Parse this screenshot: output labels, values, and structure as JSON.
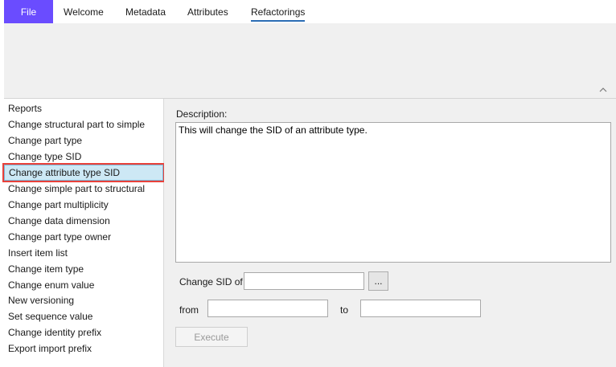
{
  "ribbon": {
    "file_label": "File",
    "tabs": [
      {
        "label": "Welcome"
      },
      {
        "label": "Metadata"
      },
      {
        "label": "Attributes"
      },
      {
        "label": "Refactorings",
        "active": true
      }
    ]
  },
  "sidebar": {
    "items": [
      {
        "label": "Reports"
      },
      {
        "label": "Change structural part to simple"
      },
      {
        "label": "Change part type"
      },
      {
        "label": "Change type SID"
      },
      {
        "label": "Change attribute type SID",
        "selected": true
      },
      {
        "label": "Change simple part to structural"
      },
      {
        "label": "Change part multiplicity"
      },
      {
        "label": "Change data dimension"
      },
      {
        "label": "Change part type owner"
      },
      {
        "label": "Insert item list"
      },
      {
        "label": "Change item type"
      },
      {
        "label": "Change enum value"
      },
      {
        "label": "New versioning"
      },
      {
        "label": "Set sequence value"
      },
      {
        "label": "Change identity prefix"
      },
      {
        "label": "Export import prefix"
      }
    ]
  },
  "main": {
    "description_label": "Description:",
    "description_text": "This will change the SID of an attribute type.",
    "change_sid_label": "Change SID of",
    "change_sid_value": "",
    "browse_label": "...",
    "from_label": "from",
    "from_value": "",
    "to_label": "to",
    "to_value": "",
    "execute_label": "Execute"
  },
  "colors": {
    "file_tab": "#6a4cff",
    "active_tab_underline": "#2b6cb4",
    "selection_fill": "#cde8f5",
    "highlight_outline": "#e8413a"
  },
  "icons": {
    "collapse_ribbon": "chevron-up-icon"
  }
}
